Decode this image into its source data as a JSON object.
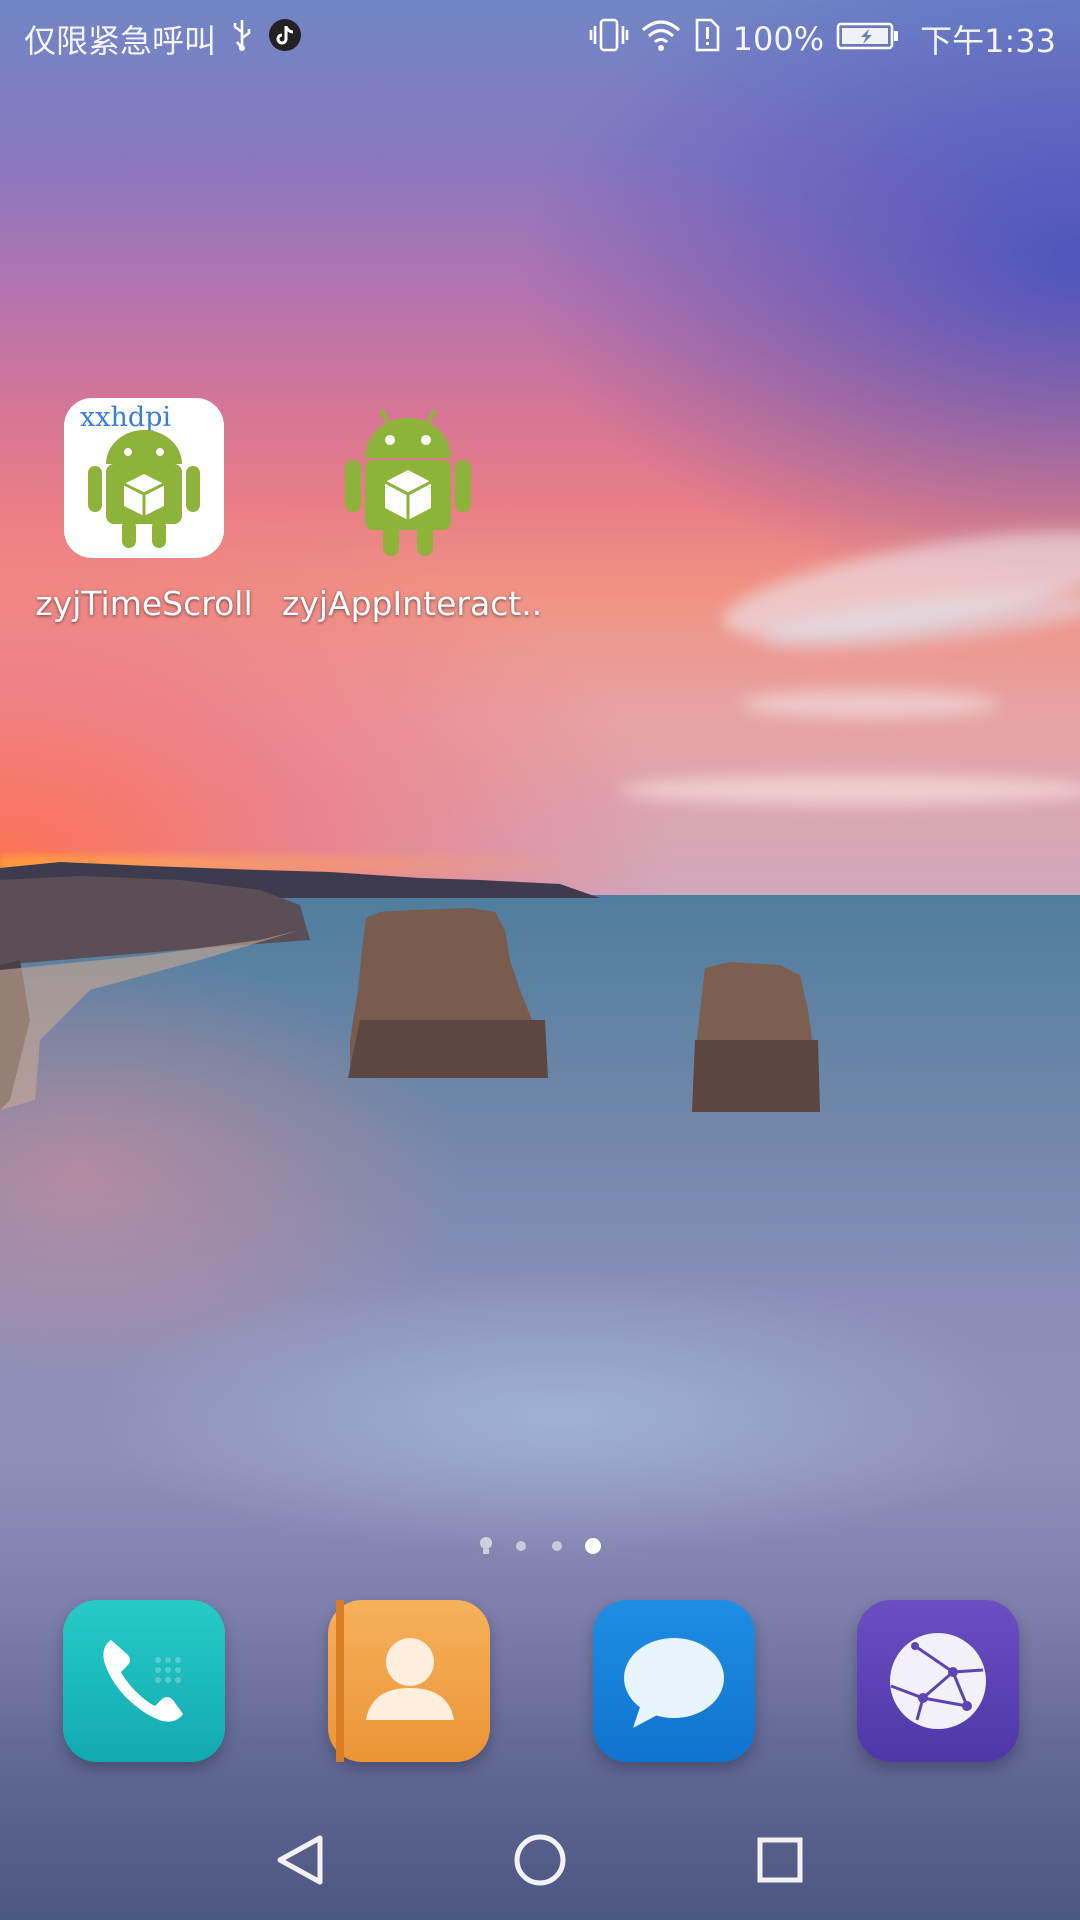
{
  "status_bar": {
    "carrier_text": "仅限紧急呼叫",
    "battery_percent": "100%",
    "time": "下午1:33",
    "icons": [
      "usb-icon",
      "tiktok-icon",
      "vibrate-icon",
      "wifi-icon",
      "sim-alert-icon",
      "battery-charging-icon"
    ]
  },
  "desktop": {
    "apps": [
      {
        "label": "zyjTimeScroll",
        "badge_text": "xxhdpi",
        "icon": "android-app-icon"
      },
      {
        "label": "zyjAppInteract..",
        "icon": "android-app-icon"
      }
    ],
    "page_indicator": {
      "pages": 4,
      "current_page": 4,
      "first_page_icon": "bulb-icon"
    }
  },
  "dock": {
    "apps": [
      {
        "name": "phone",
        "icon": "phone-icon",
        "color": "#1fbfbf"
      },
      {
        "name": "contacts",
        "icon": "contacts-icon",
        "color": "#f2a14a"
      },
      {
        "name": "messages",
        "icon": "message-icon",
        "color": "#1584dc"
      },
      {
        "name": "browser",
        "icon": "browser-icon",
        "color": "#5b44b3"
      }
    ]
  },
  "navigation_bar": {
    "buttons": [
      "back-icon",
      "home-icon",
      "recents-icon"
    ]
  }
}
